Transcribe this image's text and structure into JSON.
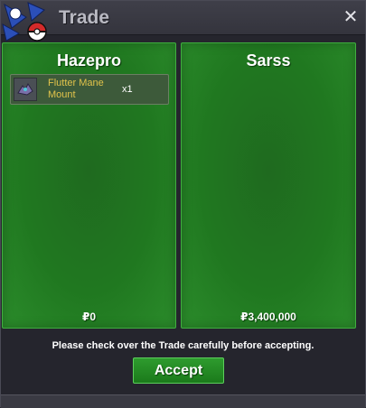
{
  "window": {
    "title": "Trade",
    "close_icon": "close-icon"
  },
  "left_panel": {
    "player_name": "Hazepro",
    "items": [
      {
        "name_line1": "Flutter Mane",
        "name_line2": "Mount",
        "quantity": "x1",
        "icon": "flutter-mane-mount-icon"
      }
    ],
    "money": "₽0"
  },
  "right_panel": {
    "player_name": "Sarss",
    "items": [],
    "money": "₽3,400,000"
  },
  "footer": {
    "notice": "Please check over the Trade carefully before accepting.",
    "accept_label": "Accept"
  },
  "colors": {
    "panel_green": "#207820",
    "accent_green": "#2e9b2e",
    "item_gold": "#e1c34b"
  }
}
